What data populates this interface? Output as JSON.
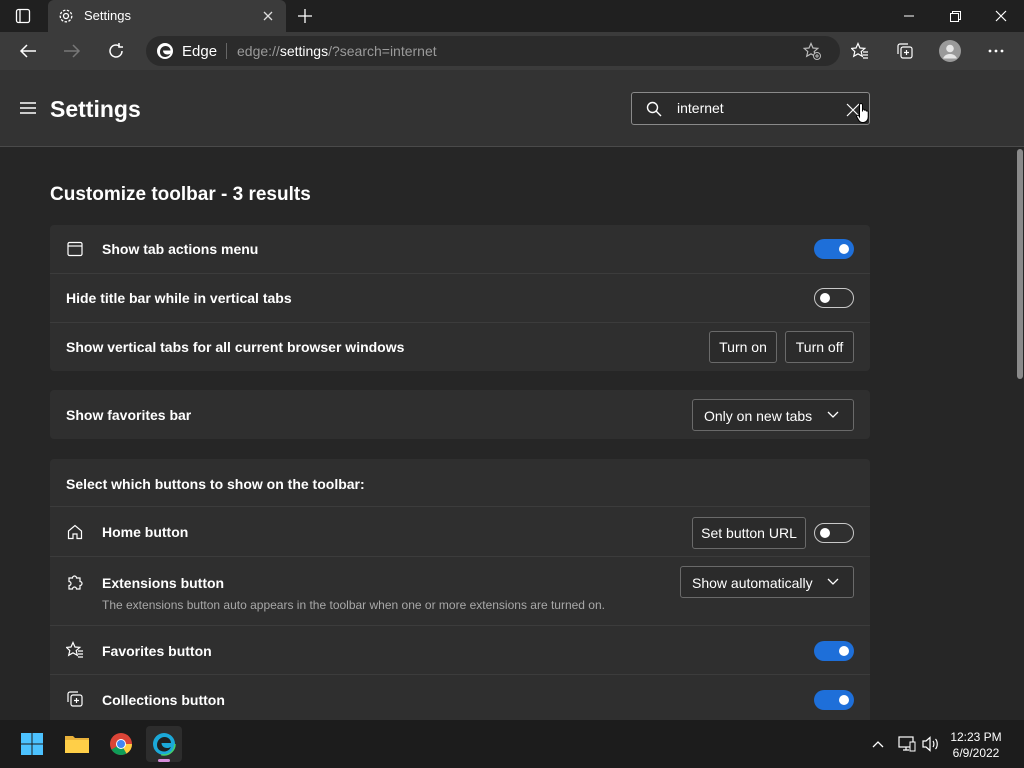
{
  "browser": {
    "tab_title": "Settings",
    "brand": "Edge",
    "url_prefix": "edge://",
    "url_host": "settings",
    "url_path": "/?search=internet"
  },
  "settings": {
    "title": "Settings",
    "search_value": "internet"
  },
  "section": {
    "title": "Customize toolbar - 3 results"
  },
  "tabs_card": {
    "rows": [
      {
        "label": "Show tab actions menu",
        "toggle": "on",
        "icon": "tab-actions-icon"
      },
      {
        "label": "Hide title bar while in vertical tabs",
        "toggle": "off"
      },
      {
        "label": "Show vertical tabs for all current browser windows",
        "btn_on": "Turn on",
        "btn_off": "Turn off"
      }
    ]
  },
  "favorites_card": {
    "label": "Show favorites bar",
    "select_value": "Only on new tabs"
  },
  "buttons_card": {
    "heading": "Select which buttons to show on the toolbar:",
    "home": {
      "label": "Home button",
      "set_url": "Set button URL",
      "toggle": "off",
      "icon": "home-icon"
    },
    "extensions": {
      "label": "Extensions button",
      "description": "The extensions button auto appears in the toolbar when one or more extensions are turned on.",
      "select_value": "Show automatically",
      "icon": "puzzle-icon"
    },
    "favorites": {
      "label": "Favorites button",
      "toggle": "on",
      "icon": "favorites-star-icon"
    },
    "collections": {
      "label": "Collections button",
      "toggle": "on",
      "icon": "collections-icon"
    }
  },
  "taskbar": {
    "time": "12:23 PM",
    "date": "6/9/2022"
  },
  "colors": {
    "accent": "#1e6fd9",
    "card": "#2f2f2f",
    "header": "#333333"
  }
}
